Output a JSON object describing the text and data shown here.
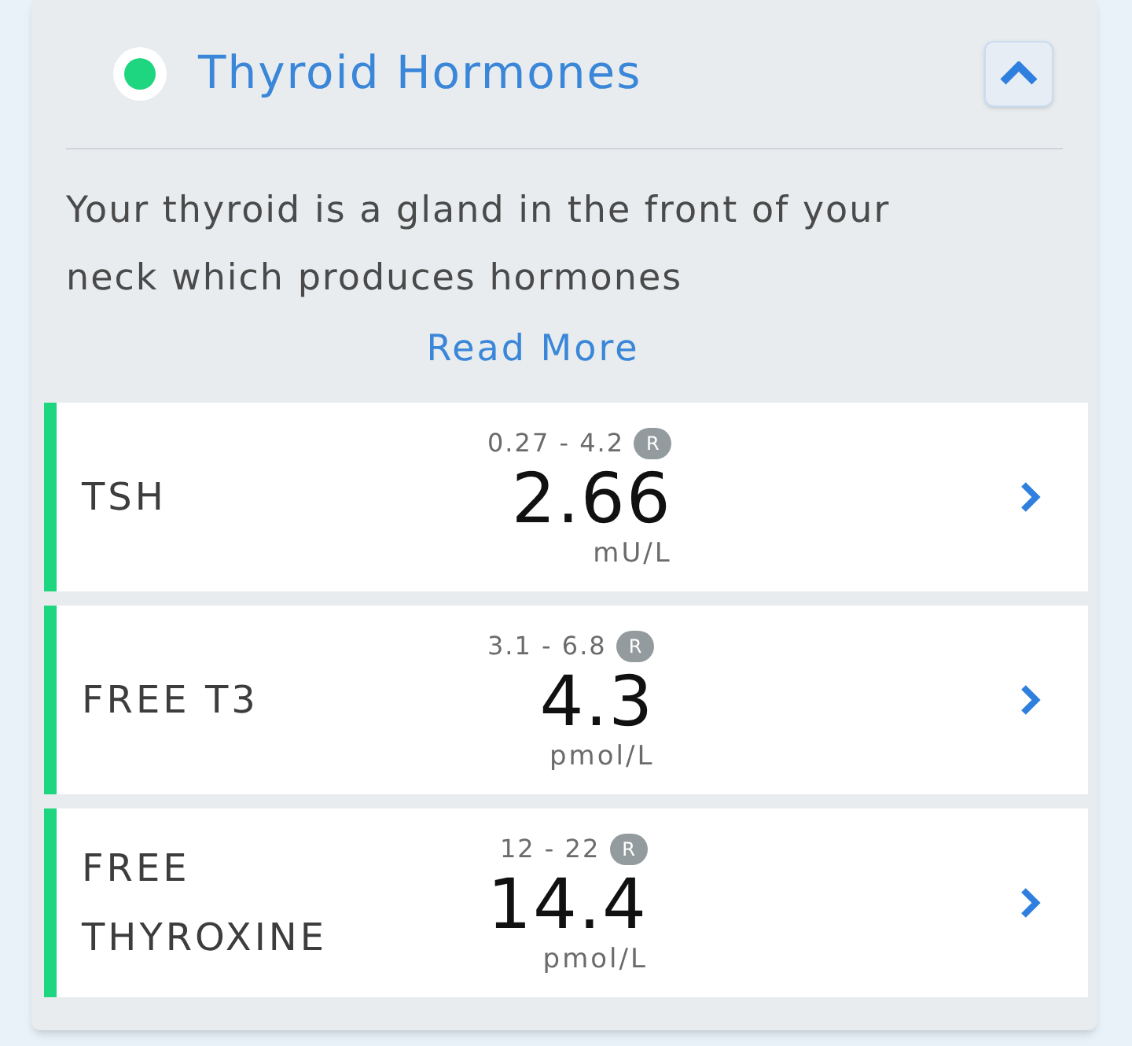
{
  "section": {
    "title": "Thyroid Hormones",
    "color": "#1ed67f",
    "expanded": true,
    "description": "Your thyroid is a gland in the front of your neck which produces hormones",
    "read_more": "Read More"
  },
  "results": [
    {
      "name": "TSH",
      "range": "0.27 - 4.2",
      "range_badge": "R",
      "value": "2.66",
      "unit": "mU/L",
      "color": "#1ed67f"
    },
    {
      "name": "FREE T3",
      "range": "3.1 - 6.8",
      "range_badge": "R",
      "value": "4.3",
      "unit": "pmol/L",
      "color": "#1ed67f"
    },
    {
      "name": "FREE THYROXINE",
      "range": "12 - 22",
      "range_badge": "R",
      "value": "14.4",
      "unit": "pmol/L",
      "color": "#1ed67f"
    }
  ]
}
